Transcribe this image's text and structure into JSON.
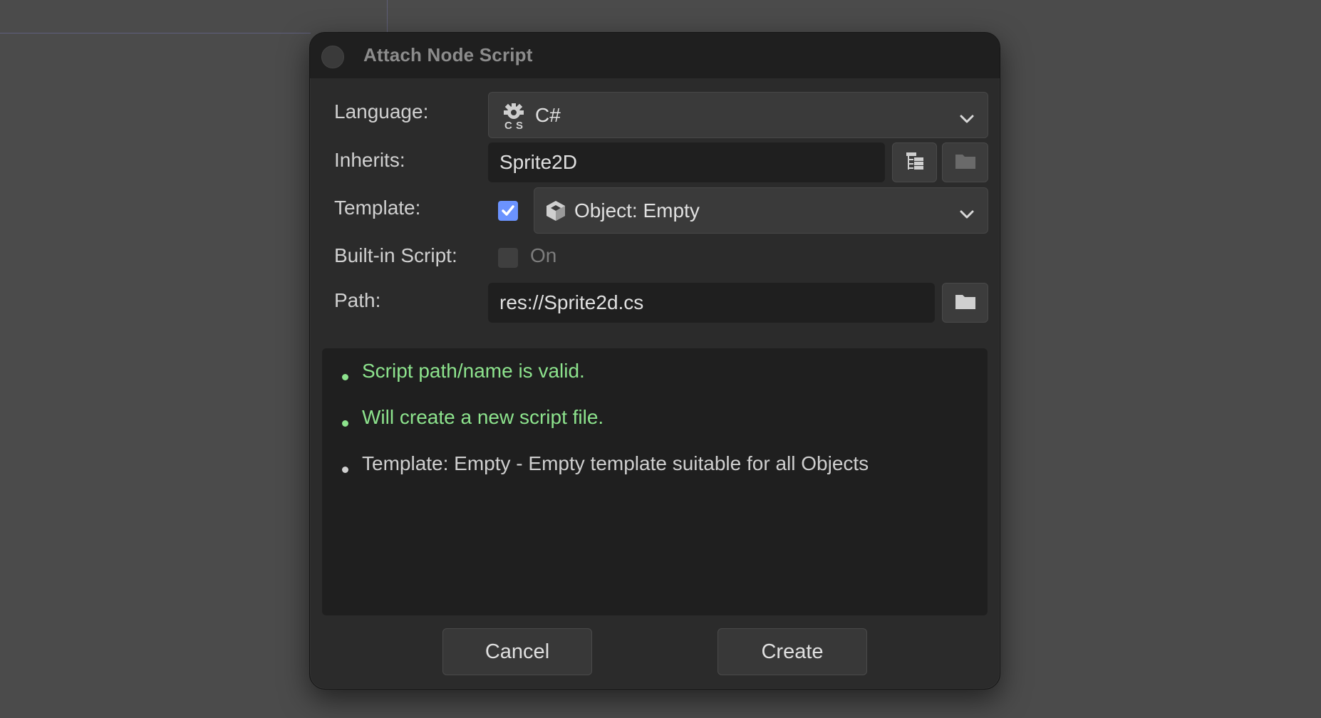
{
  "dialog": {
    "title": "Attach Node Script"
  },
  "form": {
    "language_label": "Language:",
    "language_value": "C#",
    "inherits_label": "Inherits:",
    "inherits_value": "Sprite2D",
    "template_label": "Template:",
    "template_checked": true,
    "template_value": "Object: Empty",
    "builtin_label": "Built-in Script:",
    "builtin_checked": false,
    "builtin_on_label": "On",
    "path_label": "Path:",
    "path_value": "res://Sprite2d.cs"
  },
  "messages": [
    {
      "text": "Script path/name is valid.",
      "status": "ok"
    },
    {
      "text": "Will create a new script file.",
      "status": "ok"
    },
    {
      "text": "Template: Empty - Empty template suitable for all Objects",
      "status": "info"
    }
  ],
  "buttons": {
    "cancel": "Cancel",
    "create": "Create"
  },
  "colors": {
    "background": "#4b4b4b",
    "dialog": "#2b2b2b",
    "field": "#1f1f1f",
    "accent": "#6b93ff",
    "success": "#8de38d"
  },
  "icons": {
    "language": "csharp-gear-icon",
    "template": "cube-icon",
    "inherits_tree": "tree-icon",
    "folder": "folder-icon",
    "dropdown": "chevron-down-icon"
  }
}
